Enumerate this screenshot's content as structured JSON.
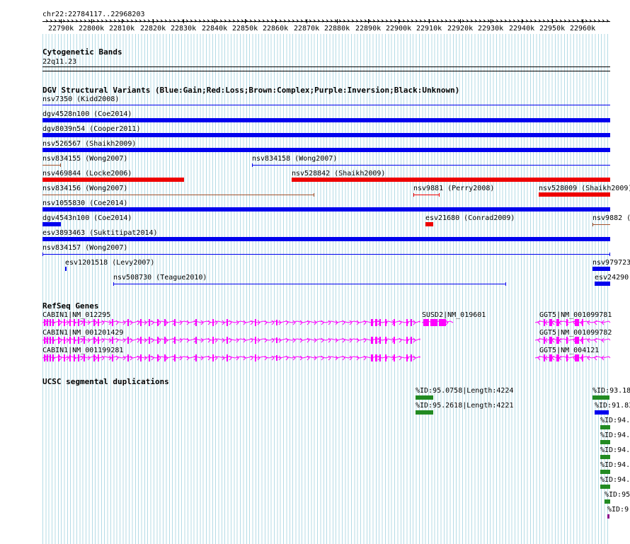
{
  "ruler": {
    "location": "chr22:22784117..22968203",
    "ticks": [
      "22790k",
      "22800k",
      "22810k",
      "22820k",
      "22830k",
      "22840k",
      "22850k",
      "22860k",
      "22870k",
      "22880k",
      "22890k",
      "22900k",
      "22910k",
      "22920k",
      "22930k",
      "22940k",
      "22950k",
      "22960k"
    ]
  },
  "tracks": {
    "cytoband": {
      "title": "Cytogenetic Bands",
      "band": "22q11.23"
    },
    "dgv": {
      "title": "DGV Structural Variants (Blue:Gain;Red:Loss;Brown:Complex;Purple:Inversion;Black:Unknown)",
      "colors": {
        "gain": "#0000ee",
        "loss": "#ee0000",
        "complex": "#a0522d",
        "inversion": "#800080",
        "unknown": "#000000"
      },
      "features": [
        {
          "label": "nsv7350 (Kidd2008)"
        },
        {
          "label": "dgv4528n100 (Coe2014)"
        },
        {
          "label": "dgv8039n54 (Cooper2011)"
        },
        {
          "label": "nsv526567 (Shaikh2009)"
        },
        {
          "label": "nsv834155 (Wong2007)"
        },
        {
          "label": "nsv834158 (Wong2007)"
        },
        {
          "label": "nsv469844 (Locke2006)"
        },
        {
          "label": "nsv528842 (Shaikh2009)"
        },
        {
          "label": "nsv834156 (Wong2007)"
        },
        {
          "label": "nsv9881 (Perry2008)"
        },
        {
          "label": "nsv528009 (Shaikh2009)"
        },
        {
          "label": "nsv1055830 (Coe2014)"
        },
        {
          "label": "dgv4543n100 (Coe2014)"
        },
        {
          "label": "esv21680 (Conrad2009)"
        },
        {
          "label": "nsv9882 ("
        },
        {
          "label": "esv3893463 (Suktitipat2014)"
        },
        {
          "label": "nsv834157 (Wong2007)"
        },
        {
          "label": "esv1201518 (Levy2007)"
        },
        {
          "label": "nsv979723"
        },
        {
          "label": "nsv508730 (Teague2010)"
        },
        {
          "label": "esv24290"
        }
      ]
    },
    "refseq": {
      "title": "RefSeq Genes",
      "color": "#ff00ff",
      "genes": [
        {
          "label": "CABIN1|NM_012295"
        },
        {
          "label": "CABIN1|NM_001201429"
        },
        {
          "label": "CABIN1|NM_001199281"
        },
        {
          "label": "SUSD2|NM_019601"
        },
        {
          "label": "GGT5|NM_001099781"
        },
        {
          "label": "GGT5|NM_001099782"
        },
        {
          "label": "GGT5|NM_004121"
        }
      ]
    },
    "segdups": {
      "title": "UCSC segmental duplications",
      "features": [
        {
          "label": "%ID:95.0758|Length:4224"
        },
        {
          "label": "%ID:95.2618|Length:4221"
        },
        {
          "label": "%ID:93.18"
        },
        {
          "label": "%ID:91.83"
        },
        {
          "label": "%ID:94."
        },
        {
          "label": "%ID:94."
        },
        {
          "label": "%ID:94."
        },
        {
          "label": "%ID:94."
        },
        {
          "label": "%ID:94."
        },
        {
          "label": "%ID:95"
        },
        {
          "label": "%ID:9"
        }
      ]
    }
  }
}
